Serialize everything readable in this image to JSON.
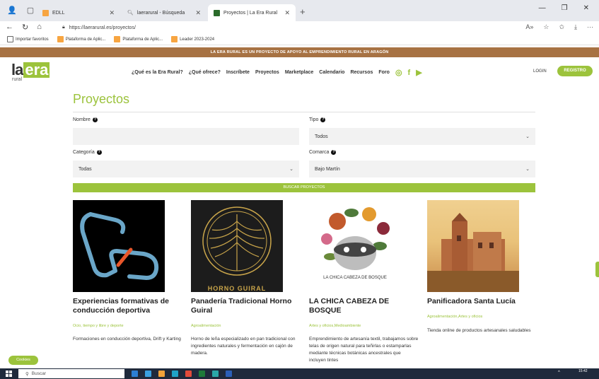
{
  "browser": {
    "tabs": [
      {
        "label": "EDLL",
        "favicon_color": "#f7a541"
      },
      {
        "label": "laerarural - Búsqueda",
        "favicon_color": "#888888"
      },
      {
        "label": "Proyectos | La Era Rural",
        "favicon_color": "#2a6b2a"
      }
    ],
    "new_tab": "+",
    "url": "https://laerarural.es/proyectos/",
    "favorites": [
      "Importar favoritos",
      "Plataforma de Aplic...",
      "Plataforma de Aplic...",
      "Leader 2023-2024"
    ]
  },
  "site": {
    "announcement": "LA ERA RURAL ES UN PROYECTO DE APOYO AL EMPRENDIMIENTO RURAL EN ARAGÓN",
    "logo": {
      "la": "la",
      "era": "era",
      "sub": "rural"
    },
    "menu": [
      "¿Qué es la Era Rural?",
      "¿Qué ofrece?",
      "Inscríbete",
      "Proyectos",
      "Marketplace",
      "Calendario",
      "Recursos",
      "Foro"
    ],
    "login": "LOGIN",
    "register": "REGISTRO",
    "brand_color": "#9cc33c"
  },
  "filters": {
    "page_title": "Proyectos",
    "nombre_label": "Nombre",
    "nombre_value": "",
    "tipo_label": "Tipo",
    "tipo_value": "Todos",
    "categoria_label": "Categoría",
    "categoria_value": "Todas",
    "comarca_label": "Comarca",
    "comarca_value": "Bajo Martín",
    "search_button": "BUSCAR PROYECTOS"
  },
  "cards": [
    {
      "title": "Experiencias formativas de conducción deportiva",
      "category": "Ocio, tiempo y libre y deporte",
      "description": "Formaciones en conducción deportiva, Drift y Karting"
    },
    {
      "title": "Panadería Tradicional Horno Guiral",
      "category": "Agroalimentación",
      "description": "Horno de leña especializado en pan tradicional con ingredientes naturales y fermentación en cajón de madera.",
      "image_text": "HORNO GUIRAL"
    },
    {
      "title": "LA CHICA CABEZA DE BOSQUE",
      "category": "Artes y oficios,Medioambiente",
      "description": "Emprendimiento de artesanía textil, trabajamos sobre telas de origen natural para teñirlas o estamparlas mediante técnicas botánicas ancestrales que incluyen tintes",
      "image_text": "LA CHICA CABEZA DE BOSQUE"
    },
    {
      "title": "Panificadora Santa Lucía",
      "category": "Agroalimentación,Artes y oficios",
      "description": "Tienda online de productos artesanales saludables"
    }
  ],
  "cookies": "Cookies",
  "taskbar": {
    "search": "Buscar",
    "time": "15:42"
  }
}
